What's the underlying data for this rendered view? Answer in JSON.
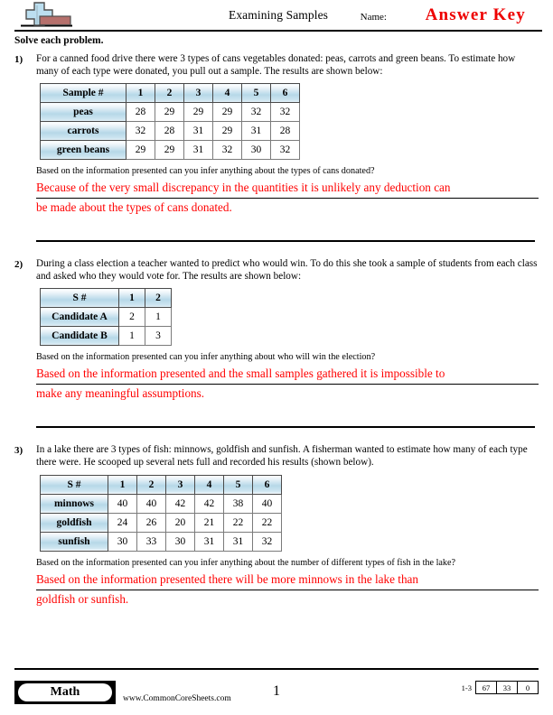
{
  "header": {
    "title": "Examining Samples",
    "name_label": "Name:",
    "answer_key": "Answer Key",
    "logo_icon": "plus-block-logo-icon"
  },
  "instructions": "Solve each problem.",
  "problems": [
    {
      "number": "1)",
      "text": "For a canned food drive there were 3 types of cans vegetables donated: peas, carrots and green beans. To estimate how many of each type were donated, you pull out a sample. The results are shown below:",
      "table": {
        "header": [
          "Sample #",
          "1",
          "2",
          "3",
          "4",
          "5",
          "6"
        ],
        "rows": [
          {
            "label": "peas",
            "values": [
              "28",
              "29",
              "29",
              "29",
              "32",
              "32"
            ]
          },
          {
            "label": "carrots",
            "values": [
              "32",
              "28",
              "31",
              "29",
              "31",
              "28"
            ]
          },
          {
            "label": "green beans",
            "values": [
              "29",
              "29",
              "31",
              "32",
              "30",
              "32"
            ]
          }
        ]
      },
      "question": "Based on the information presented can you infer anything about the types of cans donated?",
      "answer_lines": [
        "Because of the very small discrepancy in the quantities it is unlikely any deduction can",
        "be made about the types of cans donated."
      ]
    },
    {
      "number": "2)",
      "text": "During a class election a teacher wanted to predict who would win. To do this she took a sample of students from each class and asked who they would vote for. The results are shown below:",
      "table": {
        "header": [
          "S #",
          "1",
          "2"
        ],
        "rows": [
          {
            "label": "Candidate A",
            "values": [
              "2",
              "1"
            ]
          },
          {
            "label": "Candidate B",
            "values": [
              "1",
              "3"
            ]
          }
        ]
      },
      "question": "Based on the information presented can you infer anything about who will win the election?",
      "answer_lines": [
        "Based on the information presented and the small samples gathered it is impossible to",
        "make any meaningful assumptions."
      ]
    },
    {
      "number": "3)",
      "text": "In a lake there are 3 types of fish: minnows, goldfish and sunfish. A fisherman wanted to estimate how many of each type there were. He scooped up several nets full and recorded his results (shown below).",
      "table": {
        "header": [
          "S #",
          "1",
          "2",
          "3",
          "4",
          "5",
          "6"
        ],
        "rows": [
          {
            "label": "minnows",
            "values": [
              "40",
              "40",
              "42",
              "42",
              "38",
              "40"
            ]
          },
          {
            "label": "goldfish",
            "values": [
              "24",
              "26",
              "20",
              "21",
              "22",
              "22"
            ]
          },
          {
            "label": "sunfish",
            "values": [
              "30",
              "33",
              "30",
              "31",
              "31",
              "32"
            ]
          }
        ]
      },
      "question": "Based on the information presented can you infer anything about the number of different types of fish in the lake?",
      "answer_lines": [
        "Based on the information presented there will be more minnows in the lake than",
        "goldfish or sunfish."
      ]
    }
  ],
  "footer": {
    "subject": "Math",
    "url": "www.CommonCoreSheets.com",
    "page_number": "1",
    "range": "1-3",
    "score_1": "67",
    "score_2": "33",
    "score_3": "0"
  },
  "colors": {
    "answer_red": "#ff0000",
    "answer_key_red": "#ee0000",
    "table_header_blue": "#b6d8e8",
    "logo_blue": "#bcdff0",
    "logo_red": "#b5706c"
  }
}
